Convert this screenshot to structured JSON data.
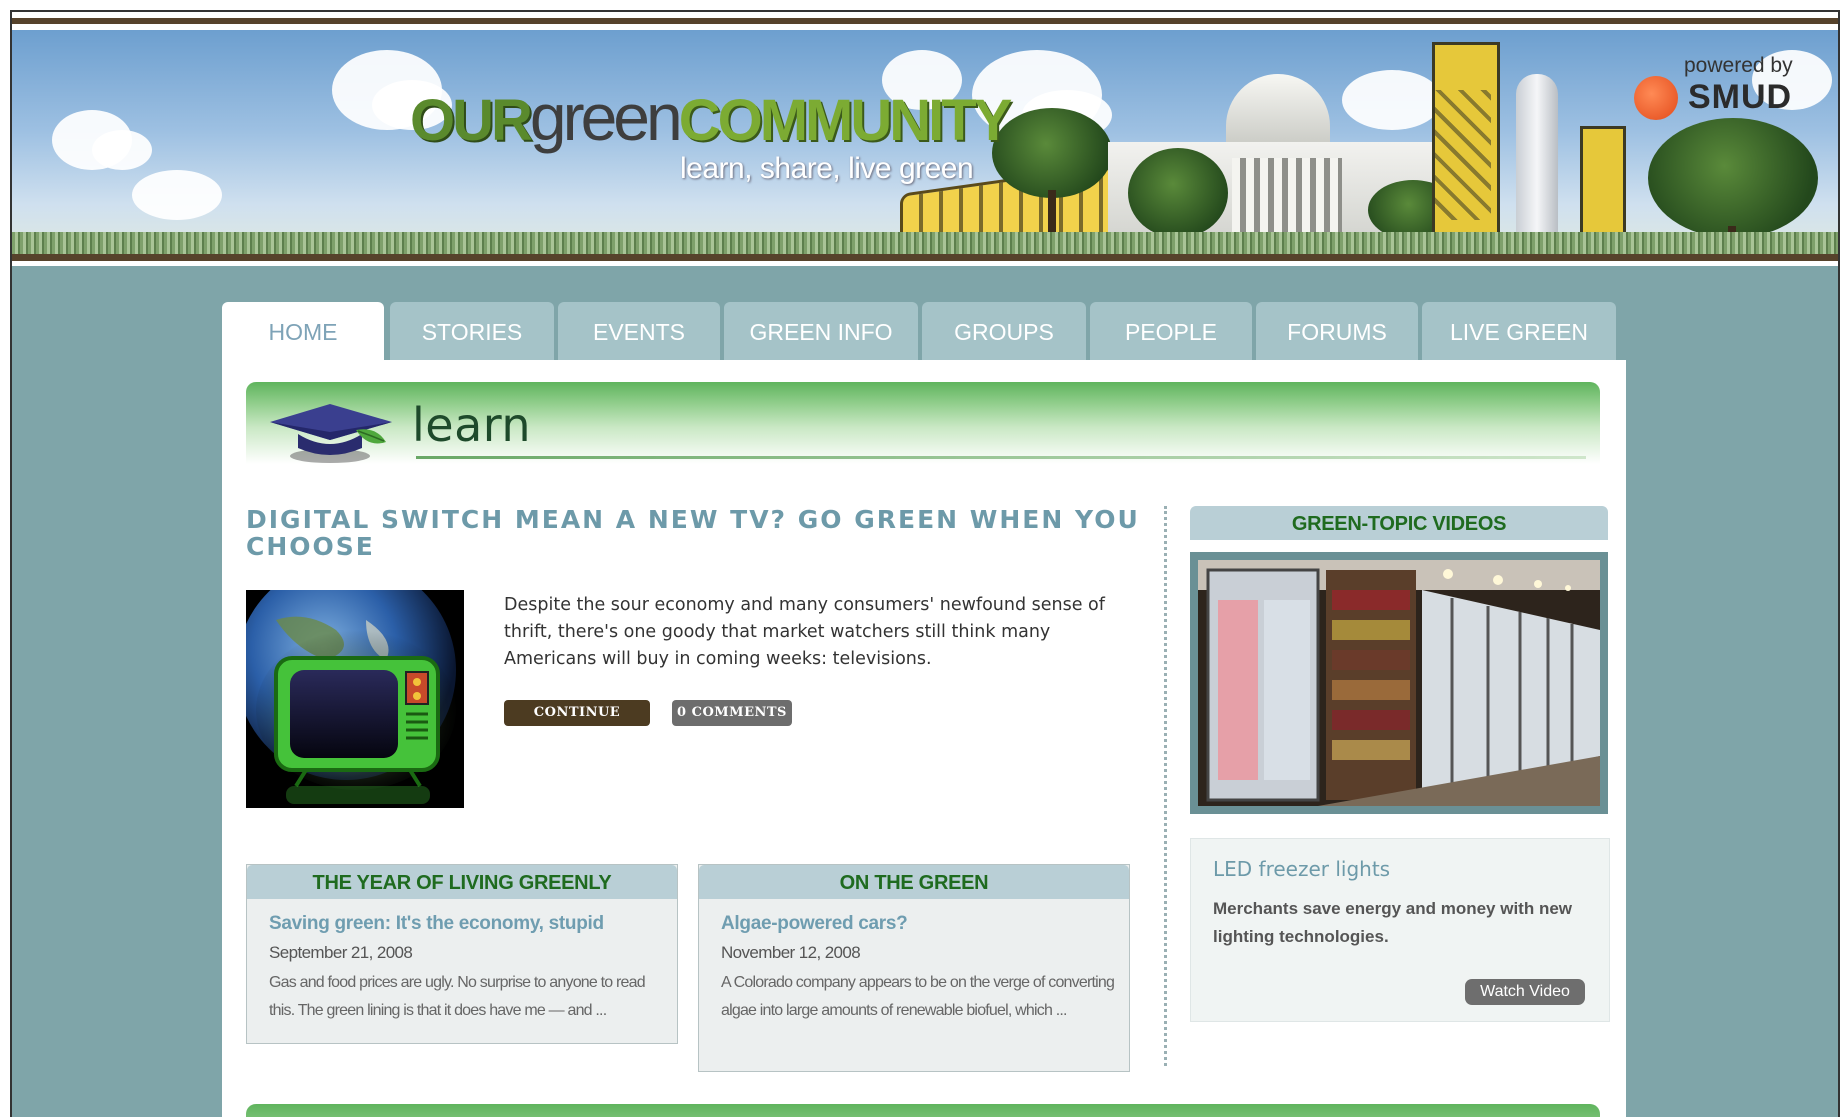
{
  "header": {
    "logo": {
      "our": "OUR",
      "green": "green",
      "community": "COMMUNITY"
    },
    "tagline": "learn, share, live green",
    "powered_by": "powered by",
    "sponsor": "SMUD"
  },
  "nav": {
    "tabs": [
      {
        "label": "HOME",
        "active": true
      },
      {
        "label": "STORIES",
        "active": false
      },
      {
        "label": "EVENTS",
        "active": false
      },
      {
        "label": "GREEN INFO",
        "active": false
      },
      {
        "label": "GROUPS",
        "active": false
      },
      {
        "label": "PEOPLE",
        "active": false
      },
      {
        "label": "FORUMS",
        "active": false
      },
      {
        "label": "LIVE GREEN",
        "active": false
      }
    ]
  },
  "section": {
    "title": "learn",
    "icon": "graduation-cap-icon"
  },
  "feature": {
    "title": "DIGITAL SWITCH MEAN A NEW TV? GO GREEN WHEN YOU CHOOSE",
    "body": "Despite the sour economy and many consumers' newfound sense of thrift, there's one goody that market watchers still think many Americans will buy in coming weeks: televisions.",
    "continue_label": "CONTINUE",
    "comments_label": "0 COMMENTS"
  },
  "columns": [
    {
      "heading": "THE YEAR OF LIVING GREENLY",
      "link": "Saving green: It's the economy, stupid",
      "date": "September 21, 2008",
      "excerpt": "Gas and food prices are ugly. No surprise to anyone to read this. The green lining is that it does have me — and ..."
    },
    {
      "heading": "ON THE GREEN",
      "link": "Algae-powered cars?",
      "date": "November 12, 2008",
      "excerpt": "A Colorado company appears to be on the verge of converting algae into large amounts of renewable biofuel, which ..."
    }
  ],
  "videos": {
    "heading": "GREEN-TOPIC VIDEOS",
    "title": "LED freezer lights",
    "description": "Merchants save energy and money with new lighting technologies.",
    "watch_label": "Watch Video"
  },
  "colors": {
    "frame_bg": "#7fa5a9",
    "tab_bg": "#a5c3c8",
    "accent_green": "#1f6b1f",
    "title_blue": "#6d9aa9",
    "brown": "#4c3b21"
  }
}
